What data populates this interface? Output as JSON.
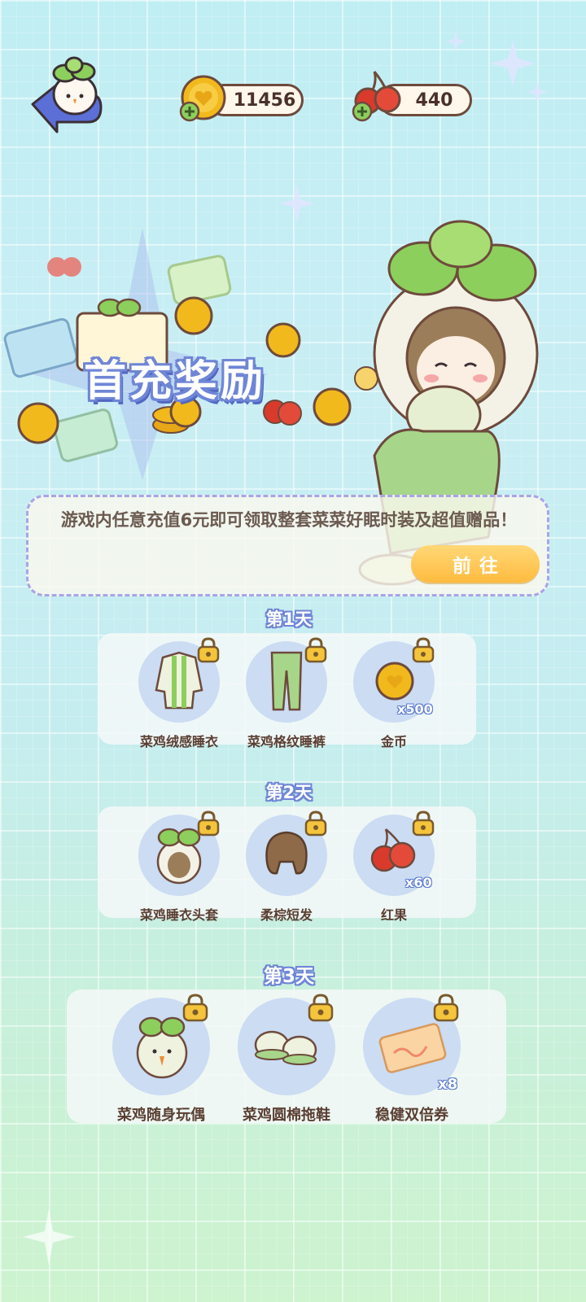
{
  "resources": {
    "coins": "11456",
    "cherries": "440"
  },
  "banner": {
    "title": "首充奖励",
    "description": "游戏内任意充值6元即可领取整套菜菜好眠时装及超值赠品！",
    "go_button": "前往"
  },
  "days": [
    {
      "label": "第1天",
      "items": [
        {
          "name": "菜鸡绒感睡衣",
          "qty": ""
        },
        {
          "name": "菜鸡格纹睡裤",
          "qty": ""
        },
        {
          "name": "金币",
          "qty": "x500"
        }
      ]
    },
    {
      "label": "第2天",
      "items": [
        {
          "name": "菜鸡睡衣头套",
          "qty": ""
        },
        {
          "name": "柔棕短发",
          "qty": ""
        },
        {
          "name": "红果",
          "qty": "x60"
        }
      ]
    },
    {
      "label": "第3天",
      "items": [
        {
          "name": "菜鸡随身玩偶",
          "qty": ""
        },
        {
          "name": "菜鸡圆棉拖鞋",
          "qty": ""
        },
        {
          "name": "稳健双倍券",
          "qty": "x8"
        }
      ]
    }
  ],
  "colors": {
    "accent_blue": "#6f86d6",
    "button_orange": "#ffbb3f",
    "coin_gold": "#f2b91c",
    "cherry_red": "#d93a2c",
    "leaf_green": "#8ccf5c"
  }
}
